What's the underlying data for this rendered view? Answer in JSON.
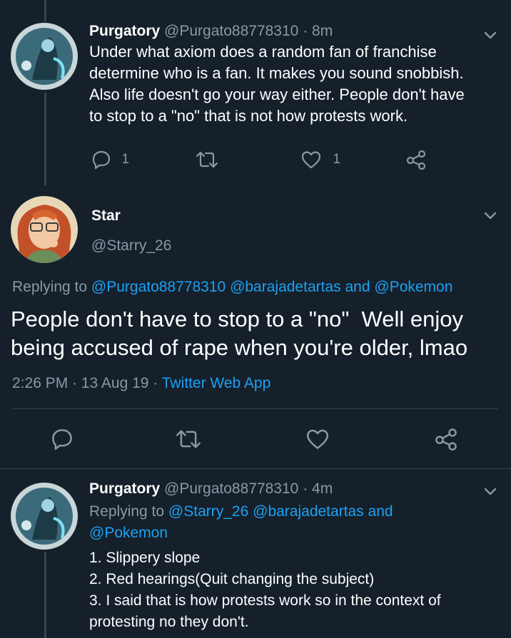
{
  "tweet1": {
    "name": "Purgatory",
    "handle": "@Purgato88778310",
    "time": "· 8m",
    "lines": [
      "Under what axiom does a random fan of franchise",
      "determine who is a fan. It makes you sound snobbish.",
      "Also life doesn't go your way either. People don't have",
      "to stop to a \"no\" that is not how protests work."
    ],
    "reply_count": "1",
    "like_count": "1"
  },
  "main": {
    "name": "Star",
    "handle": "@Starry_26",
    "replying_prefix": "Replying to",
    "replying_1": "@Purgato88778310",
    "replying_2": "@barajadetartas",
    "replying_and": "and",
    "replying_3": "@Pokemon",
    "text_line1": "People don't have to stop to a \"no\"  Well enjoy",
    "text_line2": "being accused of rape when you're older, lmao",
    "time": "2:26 PM · 13 Aug 19 · ",
    "source": "Twitter Web App"
  },
  "tweet3": {
    "name": "Purgatory",
    "handle": "@Purgato88778310",
    "time": "· 4m",
    "replying_prefix": "Replying to",
    "replying_1": "@Starry_26",
    "replying_2": "@barajadetartas",
    "replying_and": "and",
    "replying_3": "@Pokemon",
    "lines": [
      "1. Slippery slope",
      "2. Red hearings(Quit changing the subject)",
      "3. I said that is how protests work so in the context of",
      "protesting no they don't."
    ]
  },
  "colors": {
    "background": "#15202b",
    "accent": "#1da1f2",
    "secondary_text": "#8899a6"
  }
}
